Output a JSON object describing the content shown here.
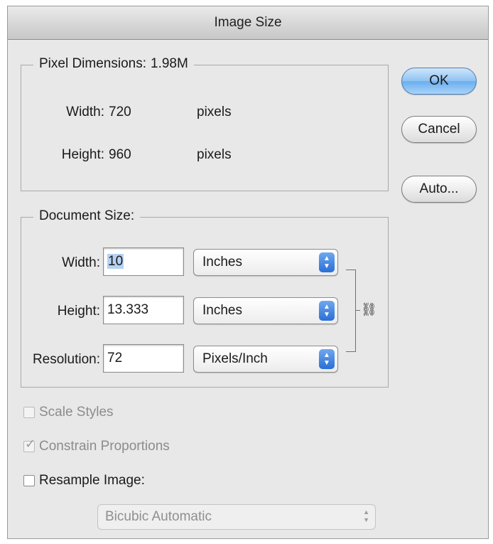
{
  "window": {
    "title": "Image Size"
  },
  "pixel_dimensions": {
    "label": "Pixel Dimensions:",
    "size": "1.98M",
    "width_label": "Width:",
    "width_value": "720",
    "width_unit": "pixels",
    "height_label": "Height:",
    "height_value": "960",
    "height_unit": "pixels"
  },
  "document_size": {
    "label": "Document Size:",
    "width_label": "Width:",
    "width_value": "10",
    "width_unit": "Inches",
    "height_label": "Height:",
    "height_value": "13.333",
    "height_unit": "Inches",
    "resolution_label": "Resolution:",
    "resolution_value": "72",
    "resolution_unit": "Pixels/Inch"
  },
  "buttons": {
    "ok": "OK",
    "cancel": "Cancel",
    "auto": "Auto..."
  },
  "options": {
    "scale_styles": {
      "label": "Scale Styles",
      "checked": false,
      "enabled": false
    },
    "constrain_proportions": {
      "label": "Constrain Proportions",
      "checked": true,
      "enabled": false
    },
    "resample_image": {
      "label": "Resample Image:",
      "checked": false,
      "enabled": true
    },
    "resample_method": "Bicubic Automatic"
  },
  "icons": {
    "link": "chain-link-icon",
    "popup_arrows": "up-down-arrows-icon"
  },
  "colors": {
    "default_button": "#8fc2f2",
    "selection": "#b5d2f3",
    "popup_arrow": "#2a6fd6"
  }
}
